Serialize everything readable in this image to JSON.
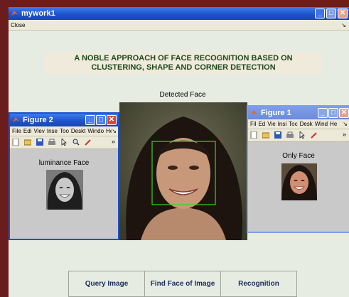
{
  "main_window": {
    "title": "mywork1",
    "menu": {
      "close": "Close",
      "arrow": "↘"
    },
    "heading_line1": "A NOBLE APPROACH OF FACE RECOGNITION BASED ON",
    "heading_line2": "CLUSTERING, SHAPE AND CORNER DETECTION",
    "detected_face_label": "Detected Face",
    "buttons": {
      "query": "Query Image",
      "find_face": "Find Face of Image",
      "recognition": "Recognition"
    }
  },
  "figure2": {
    "title": "Figure 2",
    "menu": [
      "File",
      "Edi",
      "Viev",
      "Inse",
      "Too",
      "Deskt",
      "Windo",
      "Hel"
    ],
    "menu_arrow": "↘",
    "toolbar_more": "»",
    "label": "luminance Face"
  },
  "figure1": {
    "title": "Figure 1",
    "menu": [
      "Fil",
      "Ed",
      "Vie",
      "Insi",
      "Toc",
      "Desk",
      "Wind",
      "He"
    ],
    "menu_arrow": "↘",
    "toolbar_more": "»",
    "label": "Only Face"
  },
  "colors": {
    "accent": "#1d52c9",
    "bg_panel": "#e7ece3",
    "heading_text": "#1e4a1e",
    "detect_box": "#39d41a"
  }
}
